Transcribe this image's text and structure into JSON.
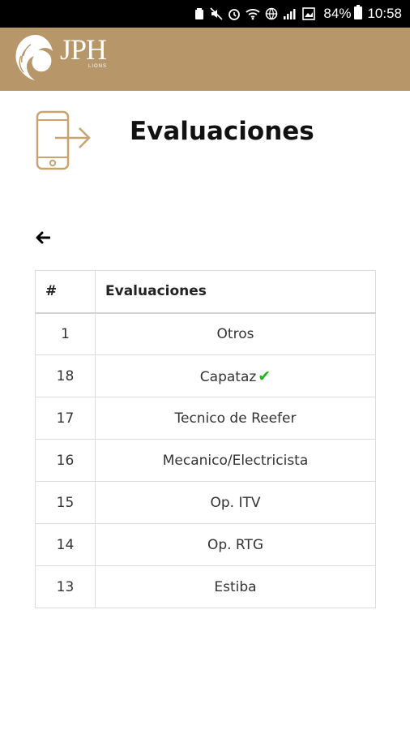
{
  "status_bar": {
    "battery_pct": "84%",
    "time": "10:58"
  },
  "header": {
    "logo_text": "JPH",
    "logo_sub": "LIONS",
    "brand_color": "#b7966a"
  },
  "page": {
    "title": "Evaluaciones"
  },
  "table": {
    "col_num_header": "#",
    "col_name_header": "Evaluaciones",
    "rows": [
      {
        "num": "1",
        "name": "Otros",
        "completed": false
      },
      {
        "num": "18",
        "name": "Capataz",
        "completed": true
      },
      {
        "num": "17",
        "name": "Tecnico de Reefer",
        "completed": false
      },
      {
        "num": "16",
        "name": "Mecanico/Electricista",
        "completed": false
      },
      {
        "num": "15",
        "name": "Op. ITV",
        "completed": false
      },
      {
        "num": "14",
        "name": "Op. RTG",
        "completed": false
      },
      {
        "num": "13",
        "name": "Estiba",
        "completed": false
      }
    ]
  }
}
